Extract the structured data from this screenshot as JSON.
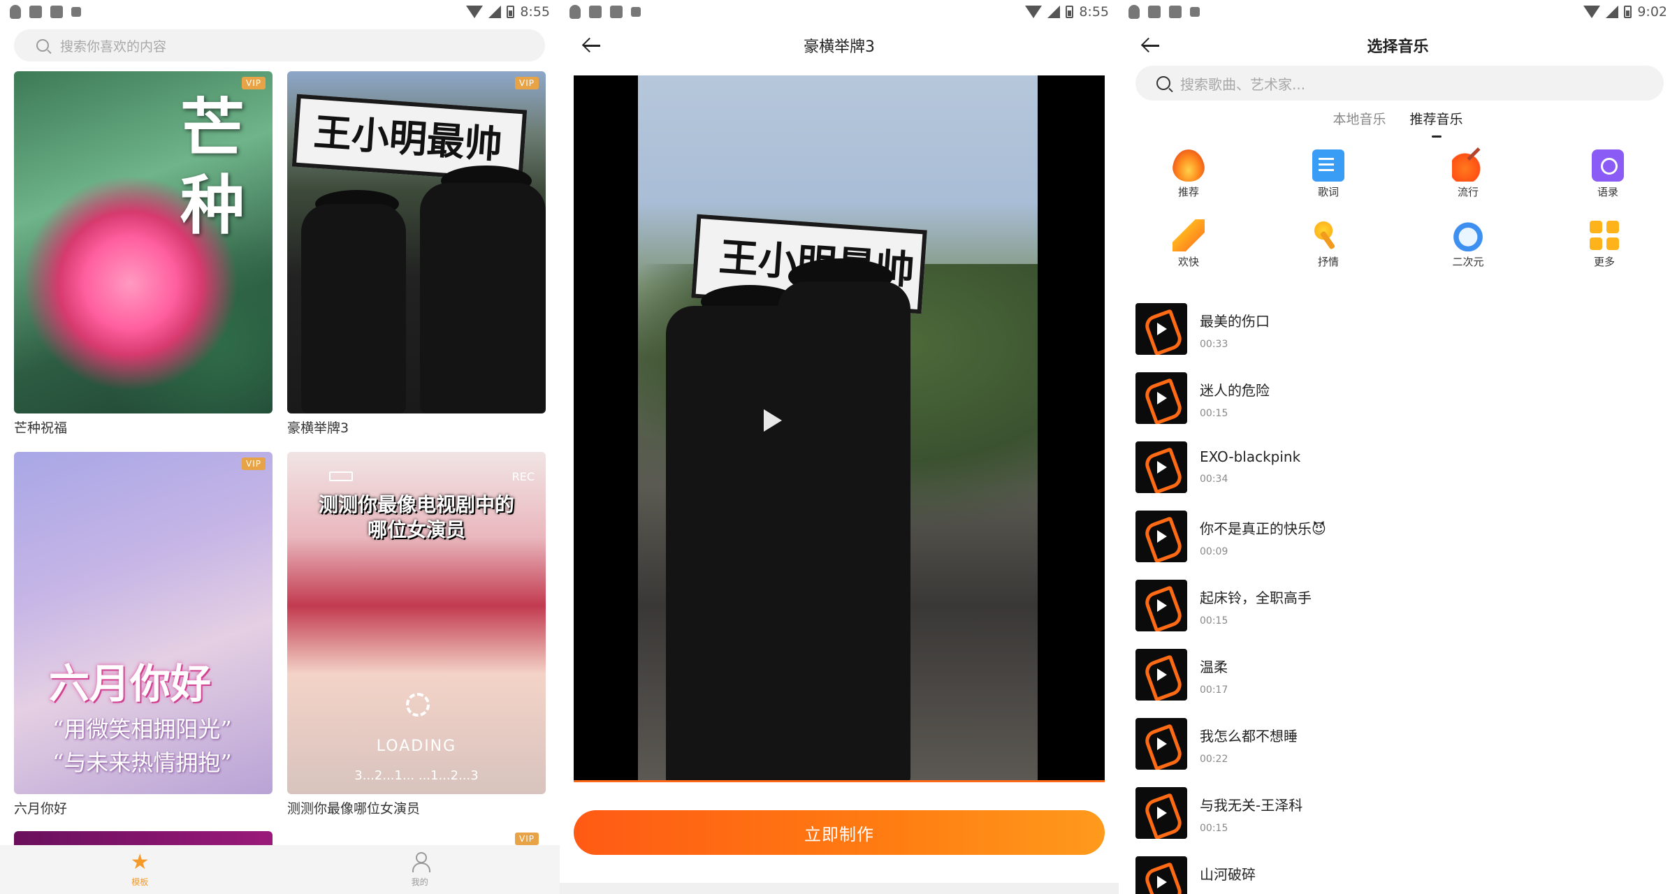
{
  "panel1": {
    "status": {
      "time": "8:55"
    },
    "search_placeholder": "搜索你喜欢的内容",
    "templates": [
      {
        "title": "芒种祝福",
        "vip": "VIP",
        "art_text": [
          "芒",
          "种"
        ]
      },
      {
        "title": "豪横举牌3",
        "vip": "VIP",
        "art_text": "王小明最帅"
      },
      {
        "title": "六月你好",
        "vip": "VIP",
        "art_text": "六月你好",
        "art_lines": [
          "“用微笑相拥阳光”",
          "“与未来热情拥抱”"
        ]
      },
      {
        "title": "测测你最像哪位女演员",
        "vip": "",
        "art_heading": [
          "测测你最像电视剧中的",
          "哪位女演员"
        ],
        "art_rec": "REC",
        "art_loading": "LOADING",
        "art_count": "3...2...1...  ...1...2...3"
      }
    ],
    "partial_cards": [
      {
        "vip": ""
      },
      {
        "vip": "VIP"
      }
    ],
    "tabs": [
      {
        "label": "模板",
        "icon": "star-icon",
        "active": true
      },
      {
        "label": "我的",
        "icon": "person-icon",
        "active": false
      }
    ],
    "accent_color": "#f39a2a"
  },
  "panel2": {
    "status": {
      "time": "8:55"
    },
    "title": "豪横举牌3",
    "video_sign_text": "王小明最帅",
    "cta_label": "立即制作",
    "accent_color": "#ff6a1a"
  },
  "panel3": {
    "status": {
      "time": "9:02"
    },
    "title": "选择音乐",
    "search_placeholder": "搜索歌曲、艺术家...",
    "segments": [
      {
        "label": "本地音乐",
        "active": false
      },
      {
        "label": "推荐音乐",
        "active": true
      }
    ],
    "categories": [
      {
        "label": "推荐",
        "icon": "fire-icon"
      },
      {
        "label": "歌词",
        "icon": "lyrics-icon"
      },
      {
        "label": "流行",
        "icon": "guitar-icon"
      },
      {
        "label": "语录",
        "icon": "quote-icon"
      },
      {
        "label": "欢快",
        "icon": "party-horn-icon"
      },
      {
        "label": "抒情",
        "icon": "microphone-icon"
      },
      {
        "label": "二次元",
        "icon": "anime-icon"
      },
      {
        "label": "更多",
        "icon": "more-grid-icon"
      }
    ],
    "songs": [
      {
        "name": "最美的伤口",
        "duration": "00:33"
      },
      {
        "name": "迷人的危险",
        "duration": "00:15"
      },
      {
        "name": "EXO-blackpink",
        "duration": "00:34"
      },
      {
        "name": "你不是真正的快乐😈",
        "duration": "00:09"
      },
      {
        "name": "起床铃，全职高手",
        "duration": "00:15"
      },
      {
        "name": "温柔",
        "duration": "00:17"
      },
      {
        "name": "我怎么都不想睡",
        "duration": "00:22"
      },
      {
        "name": "与我无关-王泽科",
        "duration": "00:15"
      },
      {
        "name": "山河破碎",
        "duration": ""
      }
    ]
  }
}
